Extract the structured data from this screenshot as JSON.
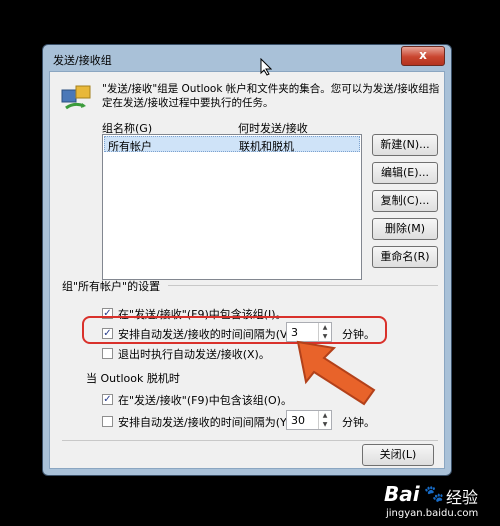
{
  "window": {
    "title": "发送/接收组",
    "close_glyph": "x"
  },
  "description": "\"发送/接收\"组是 Outlook 帐户和文件夹的集合。您可以为发送/接收组指定在发送/接收过程中要执行的任务。",
  "list": {
    "col_name": "组名称(G)",
    "col_when": "何时发送/接收",
    "rows": [
      {
        "name": "所有帐户",
        "when": "联机和脱机"
      }
    ]
  },
  "buttons": {
    "new": "新建(N)...",
    "edit": "编辑(E)...",
    "copy": "复制(C)...",
    "delete": "删除(M)",
    "rename": "重命名(R)",
    "close": "关闭(L)"
  },
  "group_settings": {
    "header": "组\"所有帐户\"的设置",
    "include_label": "在\"发送/接收\"(F9)中包含该组(I)。",
    "include_checked": true,
    "auto_label": "安排自动发送/接收的时间间隔为(V)",
    "auto_checked": true,
    "auto_value": "3",
    "minutes": "分钟。",
    "exit_label": "退出时执行自动发送/接收(X)。",
    "exit_checked": false
  },
  "offline": {
    "header": "当 Outlook 脱机时",
    "include_label": "在\"发送/接收\"(F9)中包含该组(O)。",
    "include_checked": true,
    "auto_label": "安排自动发送/接收的时间间隔为(Y)",
    "auto_checked": false,
    "auto_value": "30",
    "minutes": "分钟。"
  },
  "watermark": {
    "brand": "Bai",
    "brand2": "经验",
    "url": "jingyan.baidu.com"
  },
  "colors": {
    "highlight": "#d9312b",
    "arrow": "#e8632a",
    "selection": "#cfe3f8"
  }
}
